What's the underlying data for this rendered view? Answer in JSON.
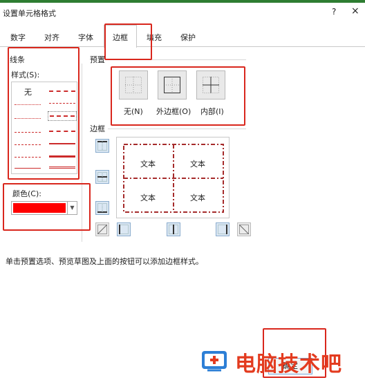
{
  "dialog": {
    "title": "设置单元格格式",
    "help_label": "?",
    "close_label": "×"
  },
  "tabs": [
    {
      "label": "数字"
    },
    {
      "label": "对齐"
    },
    {
      "label": "字体"
    },
    {
      "label": "边框",
      "active": true
    },
    {
      "label": "填充"
    },
    {
      "label": "保护"
    }
  ],
  "line": {
    "section_label": "线条",
    "style_label": "样式(S):",
    "none_label": "无",
    "color_label": "颜色(C):",
    "selected_color": "#ff0000"
  },
  "presets": {
    "section_label": "预置",
    "items": [
      {
        "label": "无(N)"
      },
      {
        "label": "外边框(O)"
      },
      {
        "label": "内部(I)"
      }
    ]
  },
  "border": {
    "section_label": "边框",
    "preview_cells": [
      "文本",
      "文本",
      "文本",
      "文本"
    ]
  },
  "info_text": "单击预置选项、预览草图及上面的按钮可以添加边框样式。",
  "ok_button_label": "确定",
  "watermark_text": "电脑技术吧",
  "colors": {
    "annotation_red": "#d9261c",
    "preview_border_red": "#a52a2a"
  }
}
